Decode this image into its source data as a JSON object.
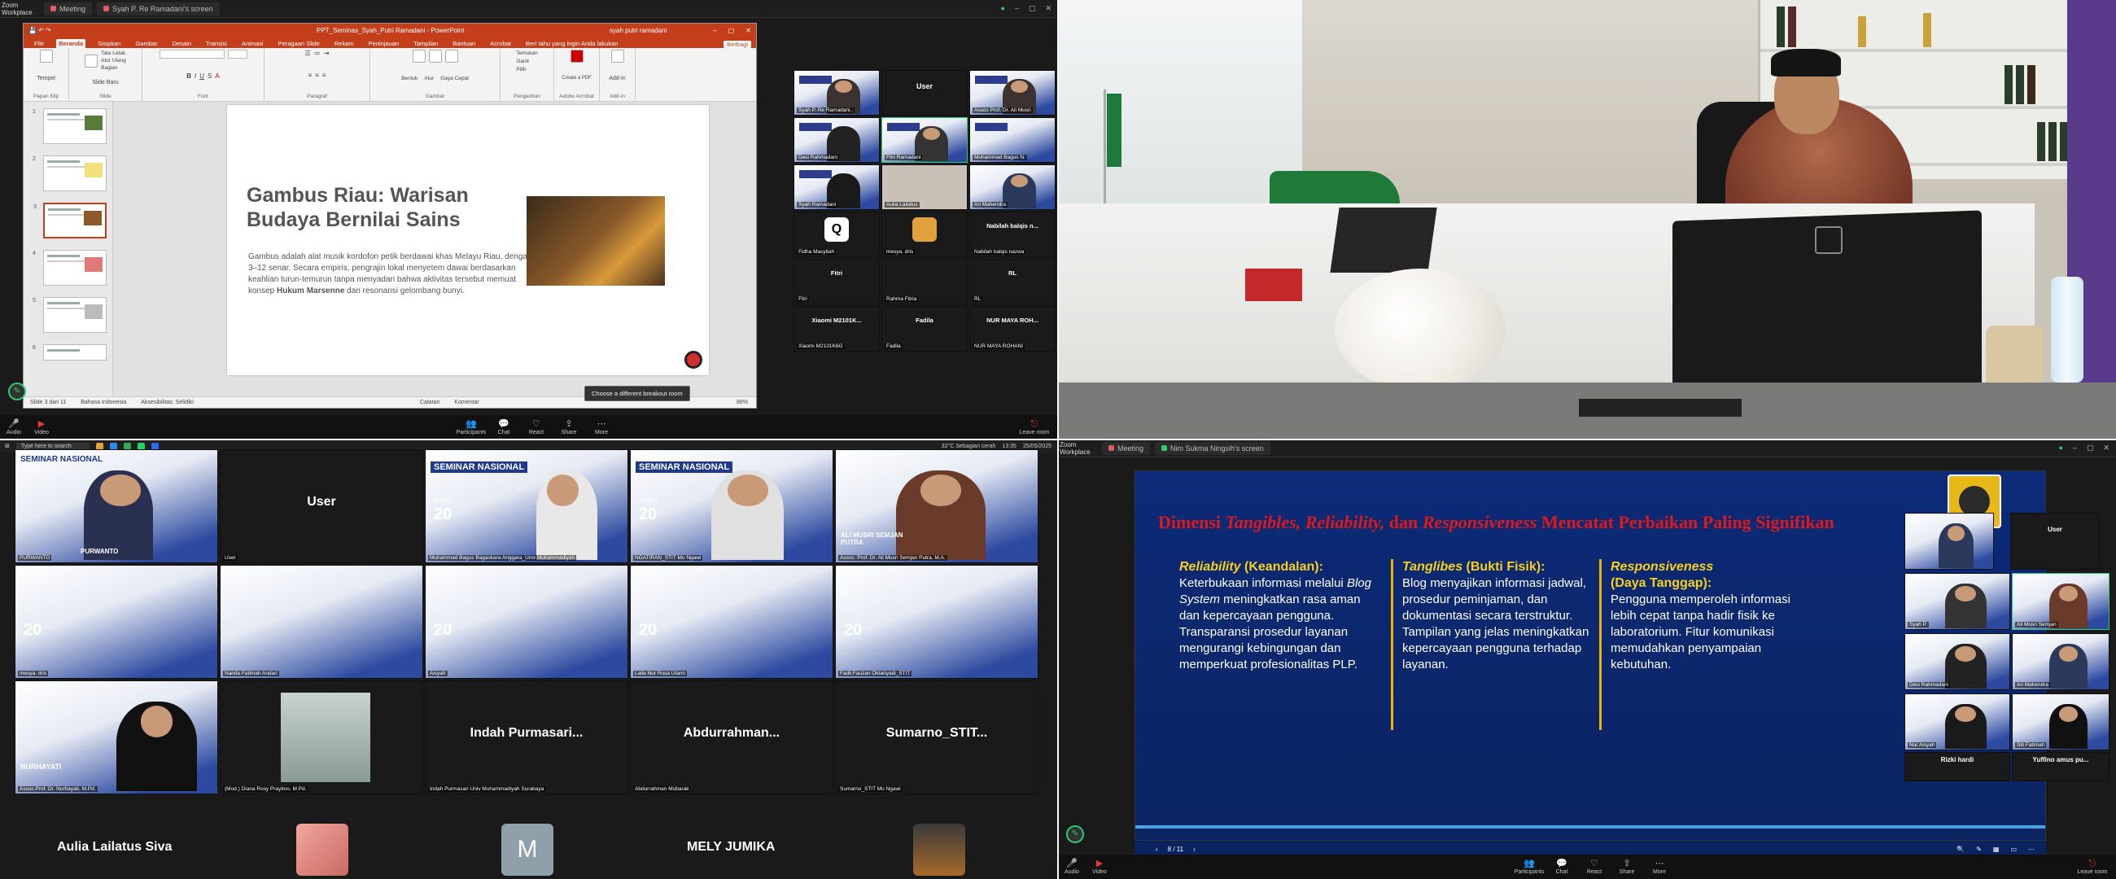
{
  "q1": {
    "workspace": "Zoom\nWorkplace",
    "tabs": [
      "Meeting",
      "Syah P. Re Ramadani's screen"
    ],
    "ppt": {
      "title": "PPT_Seminas_Syah_Putri Ramadani - PowerPoint",
      "user": "syah putri ramadani",
      "ribbon_tabs": [
        "File",
        "Beranda",
        "Sisipkan",
        "Gambar",
        "Desain",
        "Transisi",
        "Animasi",
        "Peragaan Slide",
        "Rekam",
        "Peninjauan",
        "Tampilan",
        "Bantuan",
        "Acrobat"
      ],
      "active_tab": "Beranda",
      "tell_me": "Beri tahu yang ingin Anda lakukan",
      "share_btn": "Berbagi",
      "groups": [
        "Papan Klip",
        "Slide",
        "Font",
        "Paragraf",
        "Gambar",
        "Pengeditan",
        "Adobe Acrobat",
        "Add-in"
      ],
      "paste": "Tempel",
      "new_slide": "Slide Baru",
      "layout_items": [
        "Tata Letak",
        "Atur Ulang",
        "Bagian"
      ],
      "shape_items": [
        "Bentuk",
        "Atur",
        "Gaya Cepat"
      ],
      "edit_items": [
        "Temukan",
        "Ganti",
        "Pilih"
      ],
      "acrobat": "Create a PDF",
      "addin": "Add-in",
      "slide_title": "Gambus Riau: Warisan Budaya Bernilai Sains",
      "slide_body_1": "Gambus adalah alat musik kordofon petik berdawai khas Melayu Riau, dengan 3–12 senar. Secara empiris, pengrajin lokal menyetem dawai berdasarkan keahlian turun-temurun tanpa menyadari bahwa aktivitas tersebut memuat konsep ",
      "slide_body_bold": "Hukum Marsenne",
      "slide_body_2": " dan resonansi gelombang bunyi.",
      "status_slide": "Slide 3 dari 11",
      "status_lang": "Bahasa Indonesia",
      "status_access": "Aksesibilitas: Selidiki",
      "status_notes": "Catatan",
      "status_comments": "Komentar",
      "zoom": "88%",
      "thumb_numbers": [
        "1",
        "2",
        "3",
        "4",
        "5",
        "6"
      ],
      "tooltip": "Choose a different breakout room"
    },
    "gallery": [
      {
        "name": "Syah P. Re Ramadani..",
        "label": ""
      },
      {
        "name": "",
        "label": "User"
      },
      {
        "name": "Assoc Prof. Dr. Ali Musri",
        "label": ""
      },
      {
        "name": "Desi Rahmadani",
        "label": ""
      },
      {
        "name": "Fitri Ramadani",
        "label": ""
      },
      {
        "name": "Muhammad Bagus N.",
        "label": ""
      },
      {
        "name": "Syah Ramadani",
        "label": ""
      },
      {
        "name": "Aulia Lailatus",
        "label": ""
      },
      {
        "name": "Ari Mahendra",
        "label": ""
      },
      {
        "name": "Fidha Masyitah",
        "label": ""
      },
      {
        "name": "mesya. dris",
        "label": ""
      },
      {
        "name": "Nabilah balqis nazwa",
        "label": "Nabilah balqis n..."
      },
      {
        "name": "Fitri",
        "label": "Fitri"
      },
      {
        "name": "Rahma Fitria",
        "label": ""
      },
      {
        "name": "RL",
        "label": "RL"
      },
      {
        "name": "Xiaomi M2101K6G",
        "label": "Xiaomi M2101K..."
      },
      {
        "name": "Fadila",
        "label": "Fadila"
      },
      {
        "name": "NUR MAYA ROHANI",
        "label": "NUR MAYA ROH..."
      }
    ],
    "toolbar": {
      "audio": "Audio",
      "video": "Video",
      "participants": "Participants",
      "chat": "Chat",
      "react": "React",
      "share": "Share",
      "more": "More",
      "leave": "Leave room"
    }
  },
  "q3": {
    "search": "Type here to search",
    "weather": "32°C  Sebagian cerah",
    "time": "13:35",
    "date": "25/05/2025",
    "tiles": [
      {
        "name": "PURWANTO",
        "big": "PURWANTO",
        "type": "poster-person"
      },
      {
        "name": "User",
        "big": "User",
        "type": "dark"
      },
      {
        "name": "Muhammad Bagus Bagaskara Anggara_Univ Muhammadiyah",
        "big": "",
        "type": "poster-person"
      },
      {
        "name": "NGATIRAN_STIT Mu Ngawi",
        "big": "",
        "type": "poster-person"
      },
      {
        "name": "Assoc. Prof. Dr. Ali Musri Semjan Putra, M.A.",
        "big": "ALI MUSRI SEMJAN PUTRA",
        "type": "poster-person"
      },
      {
        "name": "mesya. dris",
        "big": "",
        "type": "poster"
      },
      {
        "name": "Nanda Fatimah Andari",
        "big": "",
        "type": "poster"
      },
      {
        "name": "Aisyah",
        "big": "",
        "type": "poster"
      },
      {
        "name": "Laila Nur Rosa Utami",
        "big": "",
        "type": "poster"
      },
      {
        "name": "Fadli Fauzan Oktariyadi_STIT",
        "big": "",
        "type": "poster"
      },
      {
        "name": "Assoc.Prof. Dr. Nurhayati, M.Pd.",
        "big": "NURHAYATI",
        "type": "poster-person"
      },
      {
        "name": "(Mod.) Diana Rosy Prayitno, M.Pd.",
        "big": "",
        "type": "photo"
      },
      {
        "name": "Indah Purmasari Univ Muhammadiyah Surabaya",
        "big": "Indah Purmasari...",
        "type": "dark"
      },
      {
        "name": "Abdurrahman Mubarak",
        "big": "Abdurrahman...",
        "type": "dark"
      },
      {
        "name": "Sumarno_STIT Mu Ngawi",
        "big": "Sumarno_STIT...",
        "type": "dark"
      }
    ],
    "bottom_tiles": [
      "Aulia Lailatus Siva",
      "",
      "M",
      "MELY JUMIKA",
      ""
    ],
    "poster_title": "SEMINAR NASIONAL",
    "poster_day": "RABU",
    "poster_date": "20",
    "poster_month": "MEI"
  },
  "q4": {
    "workspace": "Zoom\nWorkplace",
    "tabs": [
      "Meeting",
      "Nim Sukma Ningsih's screen"
    ],
    "slide": {
      "title_pre": "Dimensi ",
      "title_italic": "Tangibles, Reliability,",
      "title_mid": " dan ",
      "title_italic2": "Responsiveness",
      "title_post": " Mencatat Perbaikan Paling Signifikan",
      "col1_head_italic": "Reliability",
      "col1_head_rest": " (Keandalan):",
      "col1_body_a": "Keterbukaan informasi melalui ",
      "col1_body_italic": "Blog System",
      "col1_body_b": " meningkatkan rasa aman dan kepercayaan pengguna. Transparansi prosedur layanan mengurangi kebingungan dan memperkuat profesionalitas PLP.",
      "col2_head_italic": "Tanglibes",
      "col2_head_rest": " (Bukti Fisik):",
      "col2_body": "Blog menyajikan informasi jadwal, prosedur peminjaman, dan dokumentasi secara terstruktur. Tampilan yang jelas meningkatkan kepercayaan pengguna terhadap layanan.",
      "col3_head_italic": "Responsiveness",
      "col3_head_rest": "(Daya Tanggap):",
      "col3_body": "Pengguna memperoleh informasi lebih cepat tanpa hadir fisik ke laboratorium. Fitur komunikasi memudahkan penyampaian kebutuhan.",
      "page": "8 / 11"
    },
    "gallery": [
      {
        "name": "",
        "big": ""
      },
      {
        "name": "",
        "big": "User"
      },
      {
        "name": "Syah P.",
        "big": ""
      },
      {
        "name": "Ali Musri Semjan",
        "big": ""
      },
      {
        "name": "Desi Rahmadani",
        "big": ""
      },
      {
        "name": "Ari Mahendra",
        "big": ""
      },
      {
        "name": "Nur Aisyah",
        "big": ""
      },
      {
        "name": "Siti Fatimah",
        "big": ""
      },
      {
        "name": "Rizki hardi",
        "big": "Rizki hardi"
      },
      {
        "name": "Yuffina amus pu...",
        "big": "Yuffino amus pu..."
      }
    ]
  },
  "colors": {
    "ppt_red": "#c43e1c",
    "slide_blue": "#0c2a78",
    "title_red": "#e01818",
    "gold": "#f7d019"
  }
}
